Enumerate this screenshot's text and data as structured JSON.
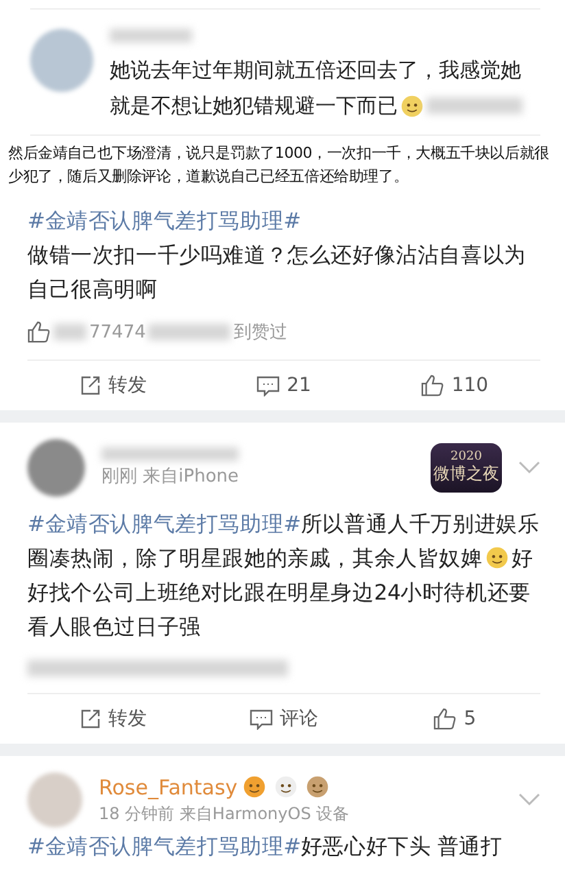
{
  "quoted_comment": {
    "lines": [
      "她说去年过年期间就五倍还回去了，我感觉她",
      "就是不想让她犯错规避一下而已"
    ]
  },
  "caption": "然后金靖自己也下场澄清，说只是罚款了1000，一次扣一千，大概五千块以后就很少犯了，随后又删除评论，道歉说自己已经五倍还给助理了。",
  "posts": [
    {
      "hashtag": "#金靖否认脾气差打骂助理#",
      "body": "做错一次扣一千少吗难道？怎么还好像沾沾自喜以为自己很高明啊",
      "liked_by": {
        "fragment": "77474",
        "suffix": "到赞过"
      },
      "actions": [
        {
          "kind": "repost",
          "label": "转发"
        },
        {
          "kind": "comment",
          "label": "21"
        },
        {
          "kind": "like",
          "label": "110"
        }
      ]
    },
    {
      "header": {
        "time": "刚刚",
        "source": "来自iPhone",
        "badge": {
          "year": "2020",
          "title": "微博之夜"
        }
      },
      "hashtag": "#金靖否认脾气差打骂助理#",
      "body": "所以普通人千万别进娱乐圈凑热闹，除了明星跟她的亲戚，其余人皆奴婢",
      "body_after_emoji": "好好找个公司上班绝对比跟在明星身边24小时待机还要看人眼色过日子强",
      "actions": [
        {
          "kind": "repost",
          "label": "转发"
        },
        {
          "kind": "comment",
          "label": "评论"
        },
        {
          "kind": "like",
          "label": "5"
        }
      ]
    },
    {
      "header": {
        "name": "Rose_Fantasy",
        "time": "18 分钟前",
        "source": "来自HarmonyOS 设备"
      },
      "hashtag": "#金靖否认脾气差打骂助理#",
      "body": "好恶心好下头 普通打"
    }
  ]
}
